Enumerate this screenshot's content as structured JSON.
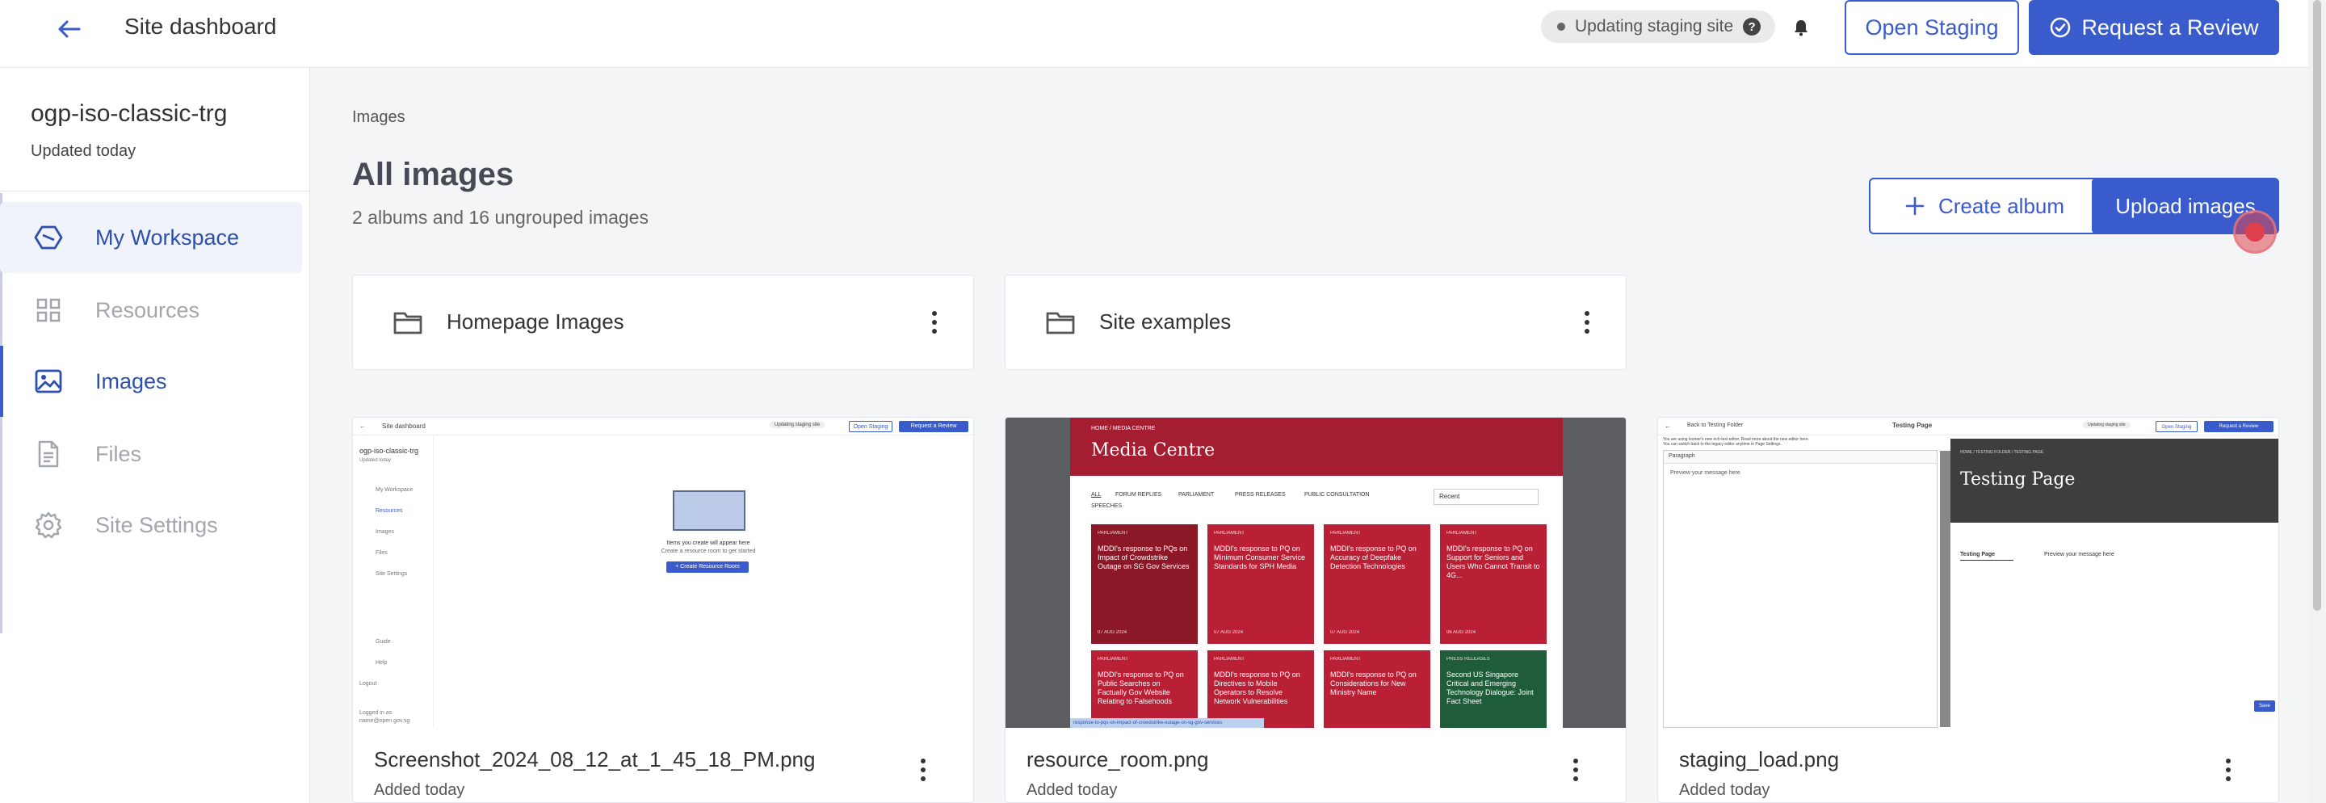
{
  "topbar": {
    "title": "Site dashboard",
    "status_text": "Updating staging site",
    "help_glyph": "?",
    "open_staging_label": "Open Staging",
    "request_review_label": "Request a Review"
  },
  "sidebar": {
    "site_name": "ogp-iso-classic-trg",
    "site_updated": "Updated today",
    "items": [
      {
        "label": "My Workspace",
        "icon": "workspace-icon",
        "state": "highlighted"
      },
      {
        "label": "Resources",
        "icon": "grid-icon",
        "state": "muted"
      },
      {
        "label": "Images",
        "icon": "image-icon",
        "state": "active"
      },
      {
        "label": "Files",
        "icon": "file-icon",
        "state": "muted"
      },
      {
        "label": "Site Settings",
        "icon": "gear-icon",
        "state": "muted"
      }
    ]
  },
  "main": {
    "breadcrumb": "Images",
    "title": "All images",
    "subtitle": "2 albums and 16 ungrouped images",
    "create_album_label": "Create album",
    "upload_label": "Upload images",
    "albums": [
      {
        "name": "Homepage Images"
      },
      {
        "name": "Site examples"
      }
    ],
    "images": [
      {
        "filename": "Screenshot_2024_08_12_at_1_45_18_PM.png",
        "added": "Added today"
      },
      {
        "filename": "resource_room.png",
        "added": "Added today"
      },
      {
        "filename": "staging_load.png",
        "added": "Added today"
      }
    ]
  },
  "thumbs": {
    "t1": {
      "title": "Site dashboard",
      "status": "Updating staging site",
      "open_staging": "Open Staging",
      "request_review": "Request a Review",
      "site": "ogp-iso-classic-trg",
      "updated": "Updated today",
      "nav": [
        "My Workspace",
        "Resources",
        "Images",
        "Files",
        "Site Settings"
      ],
      "bottom": [
        "Guide",
        "Help",
        "Logout",
        "Logged in as",
        "name@open.gov.sg"
      ],
      "empty_title": "Items you create will appear here",
      "empty_sub": "Create a resource room to get started",
      "cta": "+ Create Resource Room"
    },
    "t2": {
      "crumb": "HOME  /  MEDIA CENTRE",
      "heading": "Media Centre",
      "filters": [
        "ALL",
        "FORUM REPLIES",
        "PARLIAMENT",
        "PRESS RELEASES",
        "PUBLIC CONSULTATION",
        "SPEECHES"
      ],
      "sort": "Recent",
      "tiles": [
        {
          "cat": "PARLIAMENT",
          "text": "MDDI's response to PQs on Impact of Crowdstrike Outage on SG Gov Services",
          "date": "07 AUG 2024"
        },
        {
          "cat": "PARLIAMENT",
          "text": "MDDI's response to PQ on Minimum Consumer Service Standards for SPH Media",
          "date": "07 AUG 2024"
        },
        {
          "cat": "PARLIAMENT",
          "text": "MDDI's response to PQ on Accuracy of Deepfake Detection Technologies",
          "date": "07 AUG 2024"
        },
        {
          "cat": "PARLIAMENT",
          "text": "MDDI's response to PQ on Support for Seniors and Users Who Cannot Transit to 4G...",
          "date": "06 AUG 2024"
        },
        {
          "cat": "PARLIAMENT",
          "text": "MDDI's response to PQ on Public Searches on Factually Gov Website Relating to Falsehoods",
          "date": ""
        },
        {
          "cat": "PARLIAMENT",
          "text": "MDDI's response to PQ on Directives to Mobile Operators to Resolve Network Vulnerabilities",
          "date": ""
        },
        {
          "cat": "PARLIAMENT",
          "text": "MDDI's response to PQ on Considerations for New Ministry Name",
          "date": ""
        },
        {
          "cat": "PRESS RELEASES",
          "text": "Second US Singapore Critical and Emerging Technology Dialogue: Joint Fact Sheet",
          "date": ""
        }
      ],
      "tooltip": "response-to-pqs-on-impact-of-crowdstrike-outage-on-sg-gov-services"
    },
    "t3": {
      "back": "Back to Testing Folder",
      "title": "Testing Page",
      "status": "Updating staging site",
      "open_staging": "Open Staging",
      "request_review": "Request a Review",
      "notice": "You are using Isomer's new rich-text editor. Read more about the new editor here.",
      "notice2": "You can switch back to the legacy editor anytime in Page Settings.",
      "format": "Paragraph",
      "placeholder": "Preview your message here",
      "crumb": "HOME  /  TESTING FOLDER  /  TESTING PAGE",
      "hero": "Testing Page",
      "toc": "Testing Page",
      "body": "Preview your message here",
      "save": "Save"
    }
  }
}
